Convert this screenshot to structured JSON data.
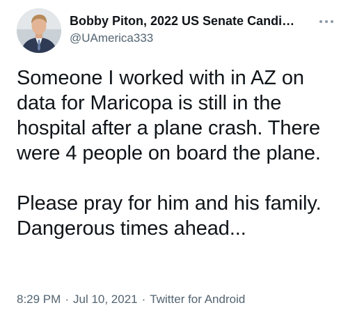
{
  "author": {
    "display_name": "Bobby Piton, 2022 US Senate Candi…",
    "handle": "@UAmerica333"
  },
  "tweet": {
    "text": "Someone I worked with in AZ on data for Maricopa is still in the hospital after a plane crash. There were 4 people on board the plane.\n\nPlease pray for him and his family. Dangerous times ahead...",
    "time": "8:29 PM",
    "date": "Jul 10, 2021",
    "separator": "·",
    "source": "Twitter for Android"
  },
  "icons": {
    "more": "more-options-icon",
    "avatar": "profile-photo"
  }
}
